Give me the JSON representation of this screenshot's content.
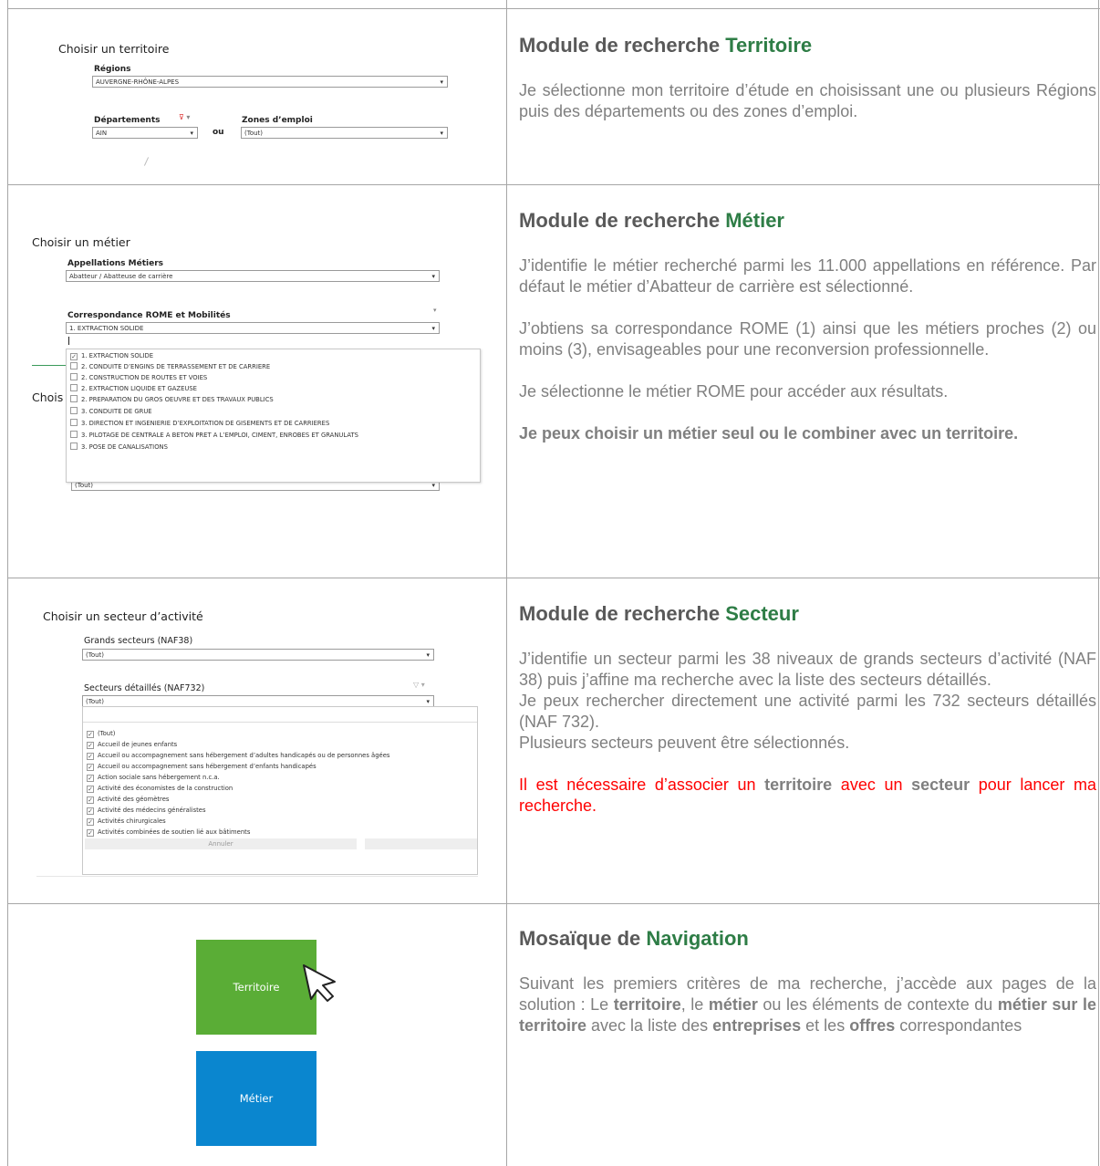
{
  "sections": [
    {
      "heading_prefix": "Module de recherche ",
      "heading_accent": "Territoire",
      "paragraphs": [
        "Je sélectionne mon territoire d’étude en choisissant une ou plusieurs Régions puis des départements ou des zones d’emploi."
      ]
    },
    {
      "heading_prefix": "Module de recherche ",
      "heading_accent": "Métier",
      "paragraphs": [
        "J’identifie le métier recherché parmi les 11.000 appellations en référence. Par défaut le métier d’Abatteur de carrière est sélectionné.",
        "J’obtiens sa correspondance ROME (1) ainsi que les métiers proches (2) ou moins (3), envisageables pour une reconversion professionnelle.",
        "Je sélectionne le métier ROME pour accéder aux résultats.",
        "Je peux choisir un métier seul ou le combiner avec un territoire."
      ]
    },
    {
      "heading_prefix": "Module de recherche ",
      "heading_accent": "Secteur",
      "paragraphs": [
        "J’identifie un secteur parmi les 38 niveaux de grands secteurs d’activité (NAF 38) puis j’affine ma recherche avec la liste des secteurs détaillés.",
        "Je peux rechercher directement une activité parmi les 732 secteurs détaillés (NAF 732).",
        "Plusieurs secteurs peuvent être sélectionnés."
      ],
      "warning": {
        "t1": "Il est nécessaire d’associer un ",
        "b1": "territoire",
        "t2": " avec un ",
        "b2": "secteur",
        "t3": " pour lancer ma recherche."
      }
    },
    {
      "heading_prefix": "Mosaïque de ",
      "heading_accent": "Navigation",
      "para": {
        "t1": "Suivant les premiers critères de ma recherche, j’accède aux pages de la solution : Le ",
        "b1": "territoire",
        "t2": ", le ",
        "b2": "métier",
        "t3": " ou les éléments de contexte du ",
        "b3": "métier sur le territoire",
        "t4": " avec la liste des ",
        "b4": "entreprises",
        "t5": " et les ",
        "b5": "offres",
        "t6": " correspondantes"
      }
    }
  ],
  "mock_territoire": {
    "title": "Choisir un territoire",
    "regions_label": "Régions",
    "regions_value": "AUVERGNE-RHÔNE-ALPES",
    "departements_label": "Départements",
    "departements_value": "AIN",
    "ou": "ou",
    "zones_label": "Zones d’emploi",
    "zones_value": "(Tout)"
  },
  "mock_metier": {
    "title": "Choisir un métier",
    "appellations_label": "Appellations Métiers",
    "appellations_value": "Abatteur / Abatteuse de carrière",
    "rome_label": "Correspondance ROME et Mobilités",
    "rome_value": "1. EXTRACTION SOLIDE",
    "hidden_title": "Chois",
    "bottom_value": "(Tout)",
    "options": [
      {
        "label": "1. EXTRACTION SOLIDE",
        "checked": true
      },
      {
        "label": "2. CONDUITE D’ENGINS DE TERRASSEMENT ET DE CARRIERE",
        "checked": false
      },
      {
        "label": "2. CONSTRUCTION DE ROUTES ET VOIES",
        "checked": false
      },
      {
        "label": "2. EXTRACTION LIQUIDE ET GAZEUSE",
        "checked": false
      },
      {
        "label": "2. PREPARATION DU GROS OEUVRE ET DES TRAVAUX PUBLICS",
        "checked": false
      },
      {
        "label": "3. CONDUITE DE GRUE",
        "checked": false
      },
      {
        "label": "3. DIRECTION ET INGENIERIE D’EXPLOITATION DE GISEMENTS ET DE CARRIERES",
        "checked": false
      },
      {
        "label": "3. PILOTAGE DE CENTRALE A BETON PRET A L’EMPLOI, CIMENT, ENROBES ET GRANULATS",
        "checked": false
      },
      {
        "label": "3. POSE DE CANALISATIONS",
        "checked": false
      }
    ]
  },
  "mock_secteur": {
    "title": "Choisir un secteur d’activité",
    "grands_label": "Grands secteurs (NAF38)",
    "grands_value": "(Tout)",
    "detail_label": "Secteurs détaillés (NAF732)",
    "detail_value": "(Tout)",
    "cancel_label": "Annuler",
    "options": [
      "(Tout)",
      "Accueil de jeunes enfants",
      "Accueil ou accompagnement sans hébergement d’adultes handicapés ou de personnes âgées",
      "Accueil ou accompagnement sans hébergement d’enfants handicapés",
      "Action sociale sans hébergement n.c.a.",
      "Activité des économistes de la construction",
      "Activité des géomètres",
      "Activité des médecins généralistes",
      "Activités chirurgicales",
      "Activités combinées de soutien lié aux bâtiments"
    ]
  },
  "tiles": {
    "territoire": "Territoire",
    "metier": "Métier",
    "territoire_color": "#5aad36",
    "metier_color": "#0a86cf"
  }
}
